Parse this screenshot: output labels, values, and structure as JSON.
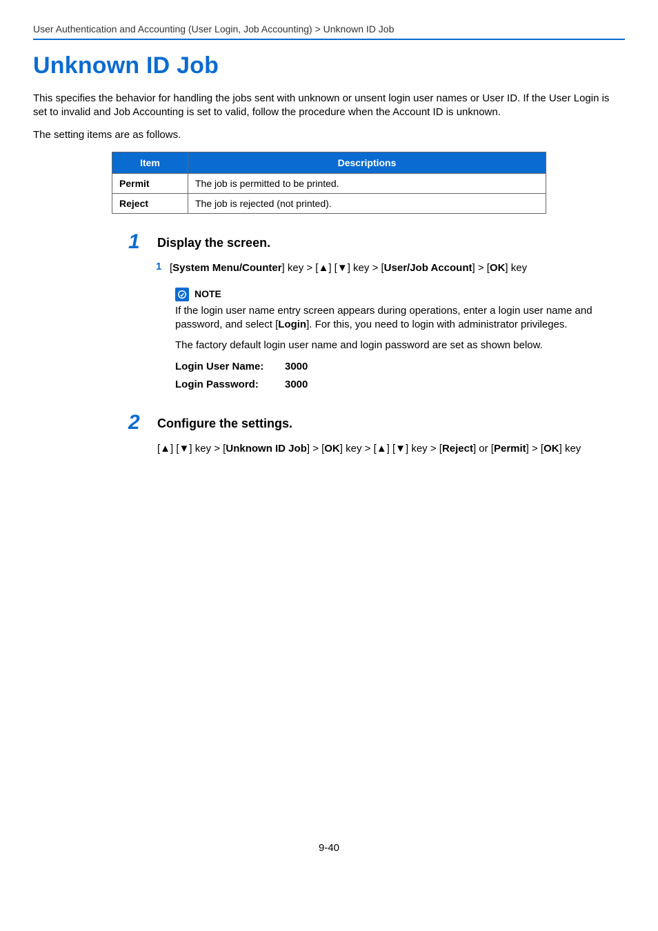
{
  "breadcrumb": "User Authentication and Accounting (User Login, Job Accounting) > Unknown ID Job",
  "title": "Unknown ID Job",
  "intro1": "This specifies the behavior for handling the jobs sent with unknown or unsent login user names or User ID. If the User Login is set to invalid and Job Accounting is set to valid, follow the procedure when the Account ID is unknown.",
  "intro2": "The setting items are as follows.",
  "table": {
    "headers": {
      "item": "Item",
      "desc": "Descriptions"
    },
    "rows": [
      {
        "item": "Permit",
        "desc": "The job is permitted to be printed."
      },
      {
        "item": "Reject",
        "desc": "The job is rejected (not printed)."
      }
    ]
  },
  "step1": {
    "num": "1",
    "title": "Display the screen.",
    "sub1": {
      "num": "1",
      "pre": "[",
      "b1": "System Menu/Counter",
      "mid1": "] key > [",
      "up": "▲",
      "mid2": "] [",
      "down": "▼",
      "mid3": "] key > [",
      "b2": "User/Job Account",
      "mid4": "] > [",
      "b3": "OK",
      "post": "] key"
    }
  },
  "note": {
    "label": "NOTE",
    "body1a": "If the login user name entry screen appears during operations, enter a login user name and password, and select [",
    "body1b": "Login",
    "body1c": "]. For this, you need to login with administrator privileges.",
    "body2": "The factory default login user name and login password are set as shown below.",
    "userLabel": "Login User Name:",
    "userVal": "3000",
    "passLabel": "Login Password:",
    "passVal": "3000"
  },
  "step2": {
    "num": "2",
    "title": "Configure the settings.",
    "seq": {
      "p1": "[",
      "up": "▲",
      "p2": "] [",
      "down": "▼",
      "p3": "] key > [",
      "b1": "Unknown ID Job",
      "p4": "] > [",
      "b2": "OK",
      "p5": "] key > [",
      "up2": "▲",
      "p6": "] [",
      "down2": "▼",
      "p7": "] key > [",
      "b3": "Reject",
      "p8": "] or [",
      "b4": "Permit",
      "p9": "] > [",
      "b5": "OK",
      "p10": "] key"
    }
  },
  "pagenum": "9-40"
}
